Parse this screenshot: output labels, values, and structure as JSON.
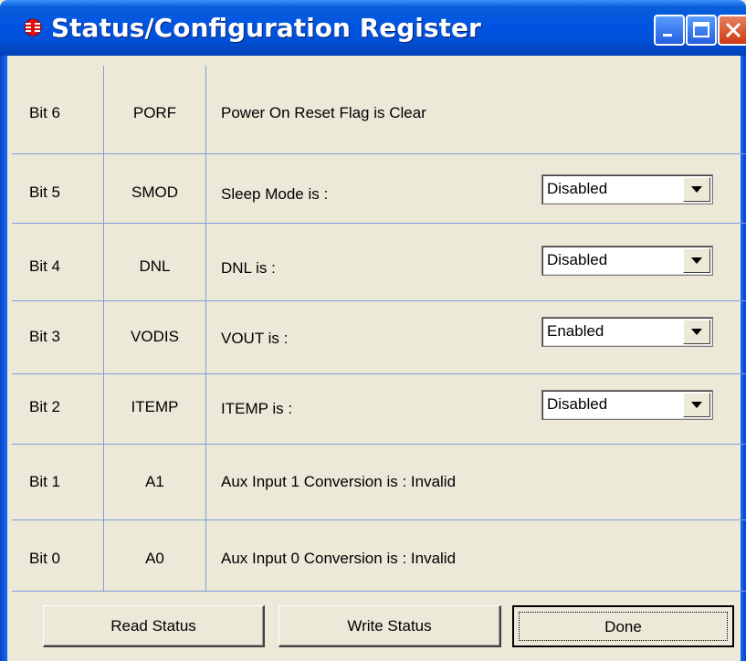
{
  "window": {
    "title": "Status/Configuration Register",
    "accent": "#0054e3",
    "close_color": "#cc3a14"
  },
  "rows": [
    {
      "bit": "Bit 6",
      "name": "PORF",
      "description": "Power On Reset Flag is Clear"
    },
    {
      "bit": "Bit 5",
      "name": "SMOD",
      "description": "Sleep Mode is :",
      "select": "Disabled"
    },
    {
      "bit": "Bit 4",
      "name": "DNL",
      "description": "DNL is :",
      "select": "Disabled"
    },
    {
      "bit": "Bit 3",
      "name": "VODIS",
      "description": "VOUT is :",
      "select": "Enabled"
    },
    {
      "bit": "Bit 2",
      "name": "ITEMP",
      "description": "ITEMP is :",
      "select": "Disabled"
    },
    {
      "bit": "Bit 1",
      "name": "A1",
      "description": "Aux Input 1 Conversion is : Invalid"
    },
    {
      "bit": "Bit 0",
      "name": "A0",
      "description": "Aux Input 0 Conversion is : Invalid"
    }
  ],
  "buttons": {
    "read": "Read Status",
    "write": "Write Status",
    "done": "Done"
  }
}
